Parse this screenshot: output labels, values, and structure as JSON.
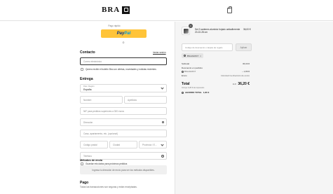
{
  "header": {
    "logo_text": "BRA"
  },
  "express": {
    "label": "Pago rápido",
    "paypal_part1": "Pay",
    "paypal_part2": "Pal",
    "or_text": "O"
  },
  "contact": {
    "title": "Contacto",
    "login_link": "Iniciar sesión",
    "email_placeholder": "Correo electrónico",
    "newsletter_label": "Quiero recibir el boletín Bra con ofertas, novedades y noticias recientes"
  },
  "delivery": {
    "title": "Entrega",
    "country_label": "País / Región",
    "country_value": "España",
    "first_name_placeholder": "Nombre",
    "last_name_placeholder": "Apellidos",
    "nif_placeholder": "NIF para pedidos superiores a 300 euros",
    "address_placeholder": "Dirección",
    "apartment_placeholder": "Casa, apartamento, etc. (opcional)",
    "postal_placeholder": "Código postal",
    "city_placeholder": "Ciudad",
    "province_label": "Provincia / E...",
    "phone_placeholder": "Teléfono",
    "save_info_label": "Guardar mis datos para próximos pedidos"
  },
  "shipping": {
    "title": "Métodos de envío",
    "notice": "Ingresa tu dirección de envío para ver los métodos disponibles."
  },
  "payment": {
    "title": "Pago",
    "subtitle": "Todas las transacciones son seguras y están encriptadas."
  },
  "summary": {
    "product": {
      "quantity": "1",
      "name": "Set 3 sartenes aluminio forjado antiadherente 20-22-28 cm",
      "price": "36,00 €"
    },
    "code_placeholder": "Código de descuento o tarjeta de regalo",
    "apply_label": "Aplicar",
    "applied_code": "BSL2024ST",
    "subtotal_label": "Subtotal",
    "subtotal_value": "36,00 €",
    "discount_label": "Descuento en pedidos",
    "discount_code": "BSL2024ST",
    "discount_value": "– 1,80 €",
    "shipping_label": "Envío",
    "shipping_value": "Introducir la dirección de envío",
    "total_label": "Total",
    "total_currency": "EUR",
    "total_value": "36,20 €",
    "tax_note": "Incluye 6,28 € de impuestos",
    "savings_label": "AHORRO TOTAL",
    "savings_value": "1,80 €"
  }
}
